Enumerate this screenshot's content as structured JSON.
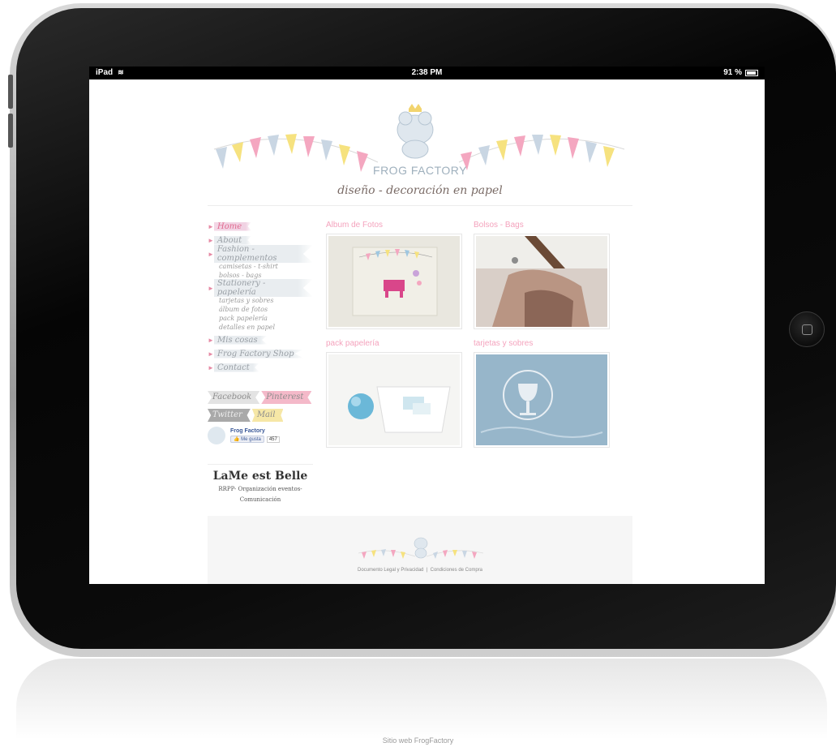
{
  "statusbar": {
    "device": "iPad",
    "time": "2:38 PM",
    "battery": "91 %"
  },
  "site": {
    "brand": "FROG FACTORY",
    "tagline": "diseño - decoración en papel",
    "nav": [
      {
        "label": "Home",
        "active": true
      },
      {
        "label": "About",
        "active": false
      },
      {
        "label": "Fashion - complementos",
        "active": false,
        "subs": [
          "camisetas - t-shirt",
          "bolsos - bags"
        ]
      },
      {
        "label": "Stationery - papelería",
        "active": false,
        "subs": [
          "tarjetas y sobres",
          "álbum de fotos",
          "pack papelería",
          "detalles en papel"
        ]
      },
      {
        "label": "Mis cosas",
        "active": false
      },
      {
        "label": "Frog Factory Shop",
        "active": false
      },
      {
        "label": "Contact",
        "active": false
      }
    ],
    "social": {
      "row1": [
        "Facebook",
        "Pinterest"
      ],
      "row2": [
        "Twitter",
        "Mail"
      ],
      "fb_name": "Frog Factory",
      "fb_like": "Me gusta",
      "fb_count": "457"
    },
    "partner": {
      "logo": "LaMe est Belle",
      "line1": "RRPP- Organización eventos-",
      "line2": "Comunicación"
    },
    "cards": [
      {
        "title": "Album de Fotos"
      },
      {
        "title": "Bolsos - Bags"
      },
      {
        "title": "pack papelería"
      },
      {
        "title": "tarjetas y sobres"
      }
    ],
    "footer": {
      "link1": "Documento Legal y Privacidad",
      "separator": "|",
      "link2": "Condiciones de Compra"
    }
  },
  "caption": "Sitio web FrogFactory",
  "colors": {
    "accent_pink": "#e06b90",
    "bunting_yellow": "#f6e27f",
    "bunting_blue": "#c9d6e3",
    "bunting_pink": "#f4a7c0"
  }
}
